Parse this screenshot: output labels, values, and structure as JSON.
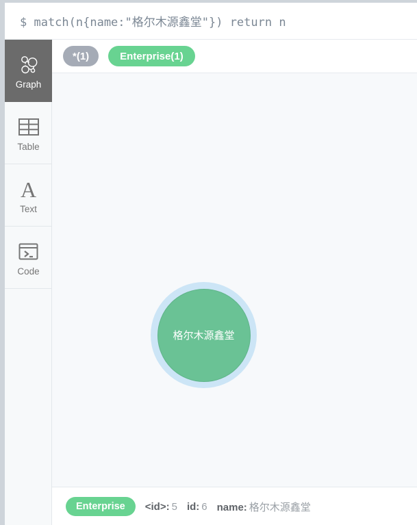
{
  "query_bar": {
    "prompt": "$",
    "query": "match(n{name:\"格尔木源鑫堂\"}) return n",
    "full_text": "$ match(n{name:\"格尔木源鑫堂\"}) return n"
  },
  "sidebar": {
    "items": [
      {
        "label": "Graph",
        "icon": "graph-network-icon",
        "active": true
      },
      {
        "label": "Table",
        "icon": "table-grid-icon",
        "active": false
      },
      {
        "label": "Text",
        "icon": "text-letter-a-icon",
        "active": false
      },
      {
        "label": "Code",
        "icon": "code-terminal-icon",
        "active": false
      }
    ]
  },
  "label_bar": {
    "pills": [
      {
        "text": "*(1)",
        "style": "gray",
        "color": "#a5abb6"
      },
      {
        "text": "Enterprise(1)",
        "style": "green",
        "color": "#68d391"
      }
    ]
  },
  "graph": {
    "node": {
      "caption": "格尔木源鑫堂",
      "fill": "#6ac295",
      "selection_ring": "#cce5f6",
      "selected": true
    },
    "canvas_background": "#f7f9fb"
  },
  "detail_bar": {
    "label": "Enterprise",
    "label_color": "#68d391",
    "properties": [
      {
        "key": "<id>:",
        "value": "5"
      },
      {
        "key": "id:",
        "value": "6"
      },
      {
        "key": "name:",
        "value": "格尔木源鑫堂"
      }
    ]
  }
}
